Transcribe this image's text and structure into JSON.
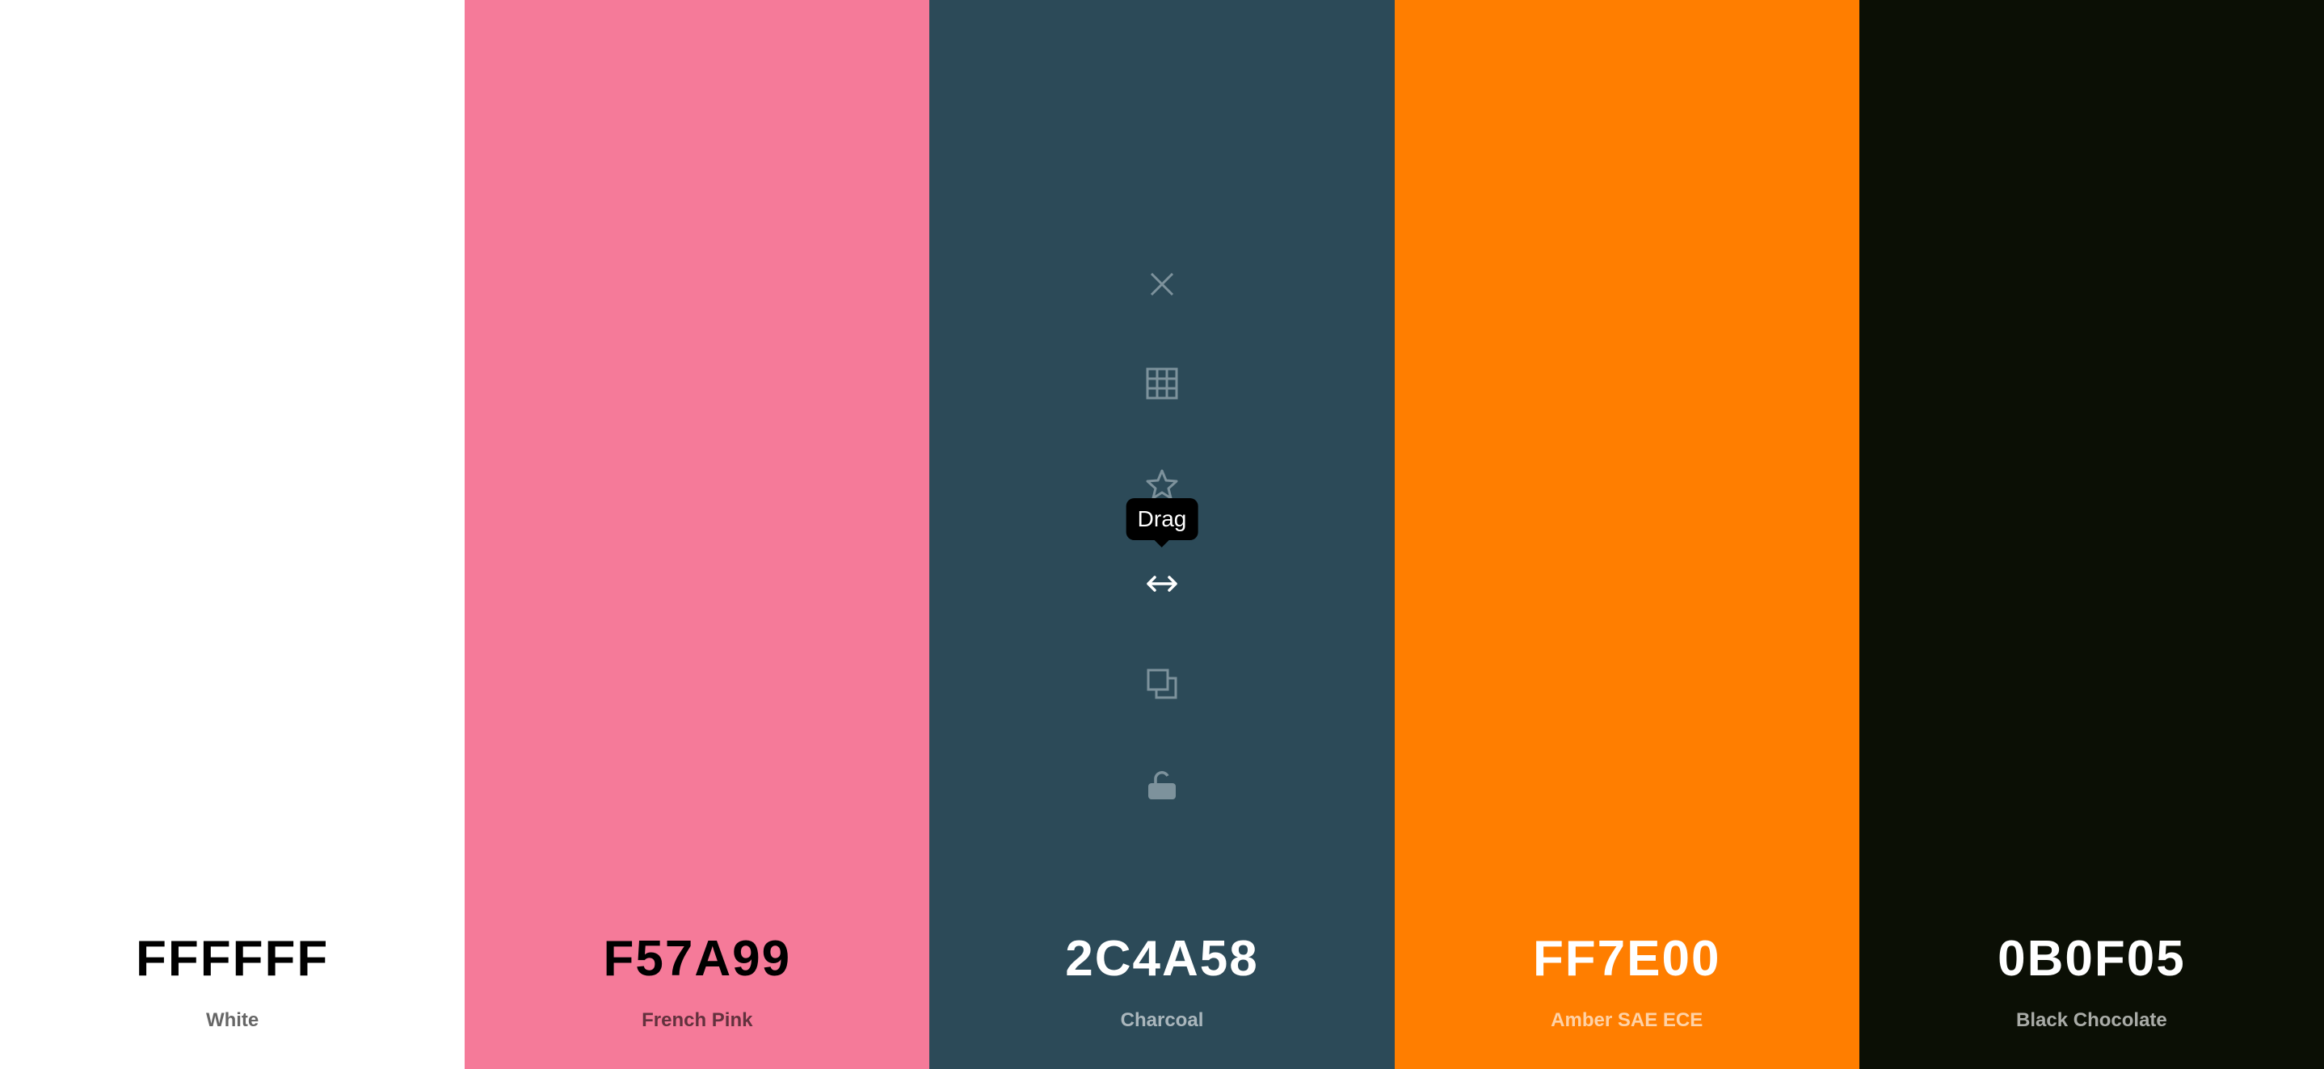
{
  "swatches": [
    {
      "hex": "FFFFFF",
      "name": "White",
      "color": "#FFFFFF",
      "text_color": "#000000",
      "name_color": "rgba(0,0,0,0.6)"
    },
    {
      "hex": "F57A99",
      "name": "French Pink",
      "color": "#F57A99",
      "text_color": "#000000",
      "name_color": "rgba(0,0,0,0.6)"
    },
    {
      "hex": "2C4A58",
      "name": "Charcoal",
      "color": "#2C4A58",
      "text_color": "#FFFFFF",
      "name_color": "rgba(255,255,255,0.6)"
    },
    {
      "hex": "FF7E00",
      "name": "Amber SAE ECE",
      "color": "#FF7E00",
      "text_color": "#FFFFFF",
      "name_color": "rgba(255,255,255,0.65)"
    },
    {
      "hex": "0B0F05",
      "name": "Black Chocolate",
      "color": "#0B0F05",
      "text_color": "#FFFFFF",
      "name_color": "rgba(255,255,255,0.65)"
    }
  ],
  "tools": {
    "tooltip": "Drag",
    "icons": [
      "close-icon",
      "grid-icon",
      "star-icon",
      "drag-arrows-icon",
      "copy-icon",
      "unlock-icon"
    ],
    "icon_color": "#7D929C",
    "active_color": "#FFFFFF"
  }
}
